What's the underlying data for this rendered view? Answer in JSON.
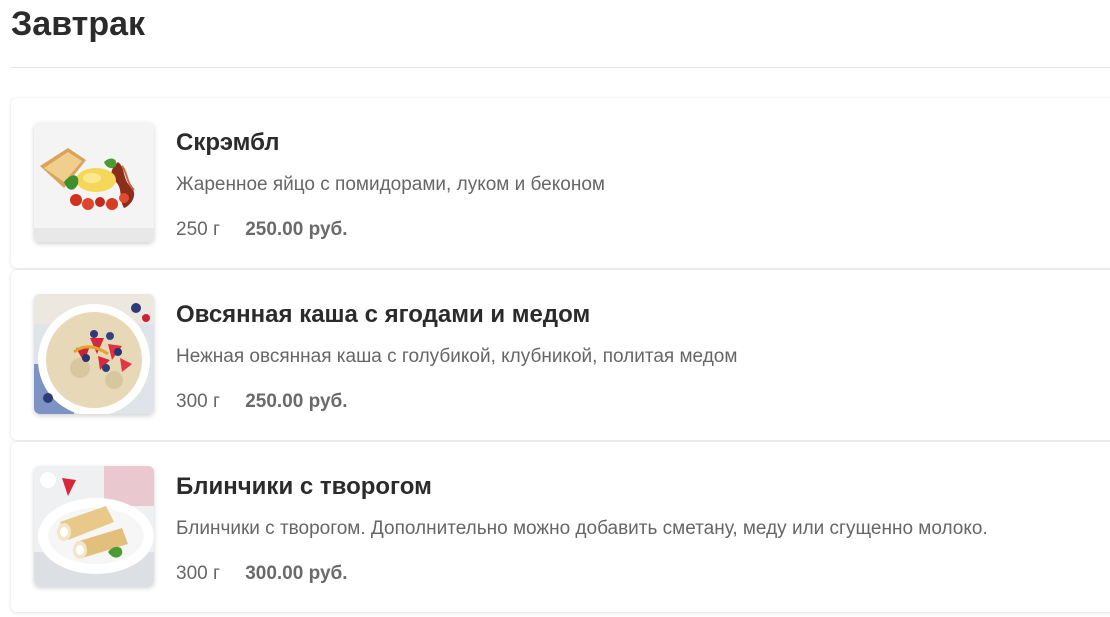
{
  "section": {
    "title": "Завтрак"
  },
  "menu_items": [
    {
      "name": "Скрэмбл",
      "description": "Жаренное яйцо с помидорами, луком и беконом",
      "weight": "250 г",
      "price": "250.00 руб.",
      "photo_icon": "scrambled-eggs-photo"
    },
    {
      "name": "Овсянная каша с ягодами и медом",
      "description": "Нежная овсянная каша с голубикой, клубникой, политая медом",
      "weight": "300 г",
      "price": "250.00 руб.",
      "photo_icon": "oatmeal-berries-photo"
    },
    {
      "name": "Блинчики с творогом",
      "description": "Блинчики с творогом. Дополнительно можно добавить сметану, меду или сгущенно молоко.",
      "weight": "300 г",
      "price": "300.00 руб.",
      "photo_icon": "pancakes-cottage-cheese-photo"
    }
  ]
}
